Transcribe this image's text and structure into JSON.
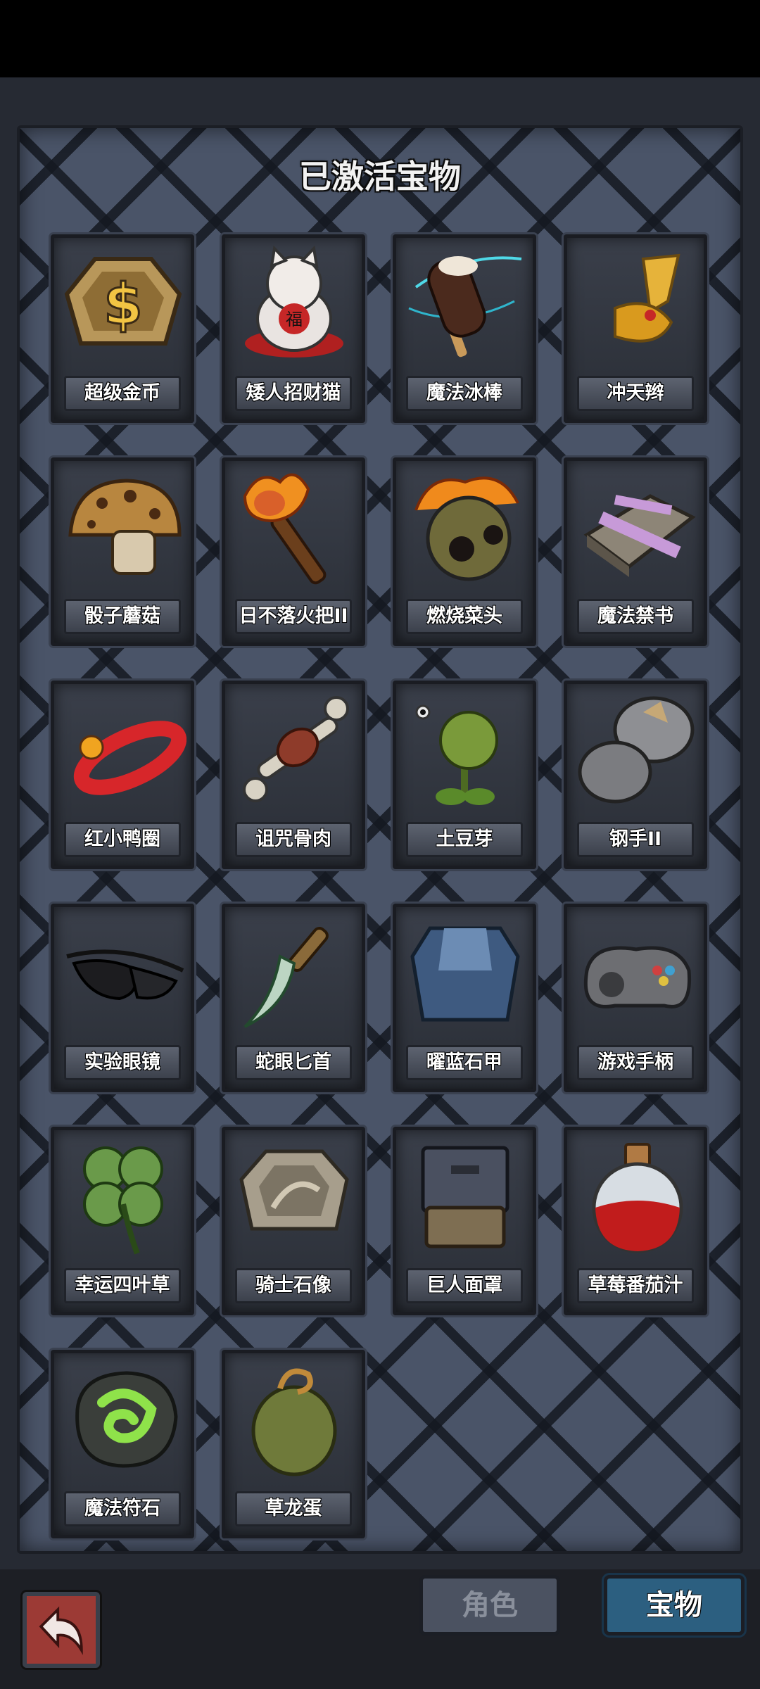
{
  "title": "已激活宝物",
  "items": [
    {
      "label": "超级金币",
      "icon": "super-coin-icon"
    },
    {
      "label": "矮人招财猫",
      "icon": "lucky-cat-icon"
    },
    {
      "label": "魔法冰棒",
      "icon": "magic-popsicle-icon"
    },
    {
      "label": "冲天辫",
      "icon": "pigtail-icon"
    },
    {
      "label": "骰子蘑菇",
      "icon": "dice-mushroom-icon"
    },
    {
      "label": "日不落火把II",
      "icon": "torch-icon"
    },
    {
      "label": "燃烧菜头",
      "icon": "burning-cabbage-icon"
    },
    {
      "label": "魔法禁书",
      "icon": "forbidden-book-icon"
    },
    {
      "label": "红小鸭圈",
      "icon": "duck-ring-icon"
    },
    {
      "label": "诅咒骨肉",
      "icon": "cursed-meat-bone-icon"
    },
    {
      "label": "土豆芽",
      "icon": "potato-sprout-icon"
    },
    {
      "label": "钢手II",
      "icon": "steel-gauntlet-icon"
    },
    {
      "label": "实验眼镜",
      "icon": "lab-goggles-icon"
    },
    {
      "label": "蛇眼匕首",
      "icon": "snake-eye-dagger-icon"
    },
    {
      "label": "曜蓝石甲",
      "icon": "blue-stone-armor-icon"
    },
    {
      "label": "游戏手柄",
      "icon": "gamepad-icon"
    },
    {
      "label": "幸运四叶草",
      "icon": "four-leaf-clover-icon"
    },
    {
      "label": "骑士石像",
      "icon": "knight-statue-icon"
    },
    {
      "label": "巨人面罩",
      "icon": "giant-mask-icon"
    },
    {
      "label": "草莓番茄汁",
      "icon": "juice-bottle-icon"
    },
    {
      "label": "魔法符石",
      "icon": "magic-rune-stone-icon"
    },
    {
      "label": "草龙蛋",
      "icon": "grass-dragon-egg-icon"
    }
  ],
  "tabs": {
    "role": "角色",
    "treasure": "宝物"
  },
  "back_icon": "return-arrow-icon",
  "colors": {
    "tab_active": "#2c5f80",
    "tab_inactive": "#4b5261",
    "back_button": "#9c3a35"
  }
}
